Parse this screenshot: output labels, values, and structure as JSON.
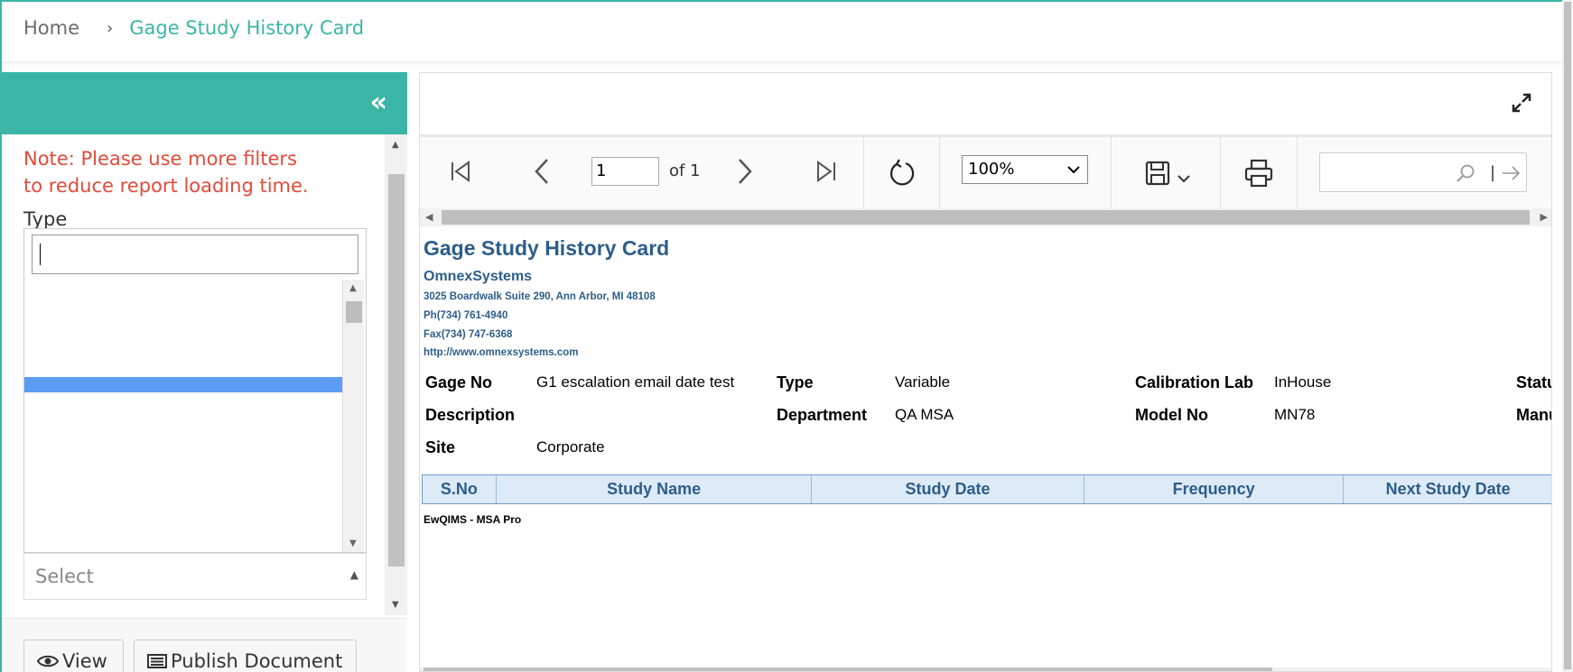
{
  "breadcrumb": {
    "home": "Home",
    "separator": "›",
    "current": "Gage Study History Card"
  },
  "filter_panel": {
    "collapse_icon": "double-chevron-left-icon",
    "note": "Note: Please use more filters to reduce report loading time.",
    "type_label": "Type",
    "search_value": "",
    "select_placeholder": "Select",
    "view_button": "View",
    "publish_button": "Publish Document"
  },
  "toolbar": {
    "page_number": "1",
    "page_of": "of 1",
    "zoom": "100%",
    "search_value": ""
  },
  "report": {
    "title": "Gage Study History Card",
    "company": "OmnexSystems",
    "address": "3025 Boardwalk Suite 290, Ann Arbor, MI 48108",
    "phone": "Ph(734) 761-4940",
    "fax": "Fax(734) 747-6368",
    "website": "http://www.omnexsystems.com",
    "fields": {
      "gage_no_label": "Gage No",
      "gage_no_value": "G1 escalation email date test",
      "type_label": "Type",
      "type_value": "Variable",
      "calibration_lab_label": "Calibration Lab",
      "calibration_lab_value": "InHouse",
      "status_label": "Statu",
      "description_label": "Description",
      "description_value": "",
      "department_label": "Department",
      "department_value": "QA MSA",
      "model_no_label": "Model No",
      "model_no_value": "MN78",
      "manufacturer_label": "Manu",
      "site_label": "Site",
      "site_value": "Corporate"
    },
    "table_headers": [
      "S.No",
      "Study Name",
      "Study Date",
      "Frequency",
      "Next Study Date"
    ],
    "footer_text": "EwQIMS - MSA Pro"
  },
  "colors": {
    "accent": "#3bb5a5",
    "note_red": "#e24b3b",
    "report_blue": "#2d5d8a",
    "table_header_bg": "#ddeaf7",
    "highlight": "#5b9cf5"
  }
}
